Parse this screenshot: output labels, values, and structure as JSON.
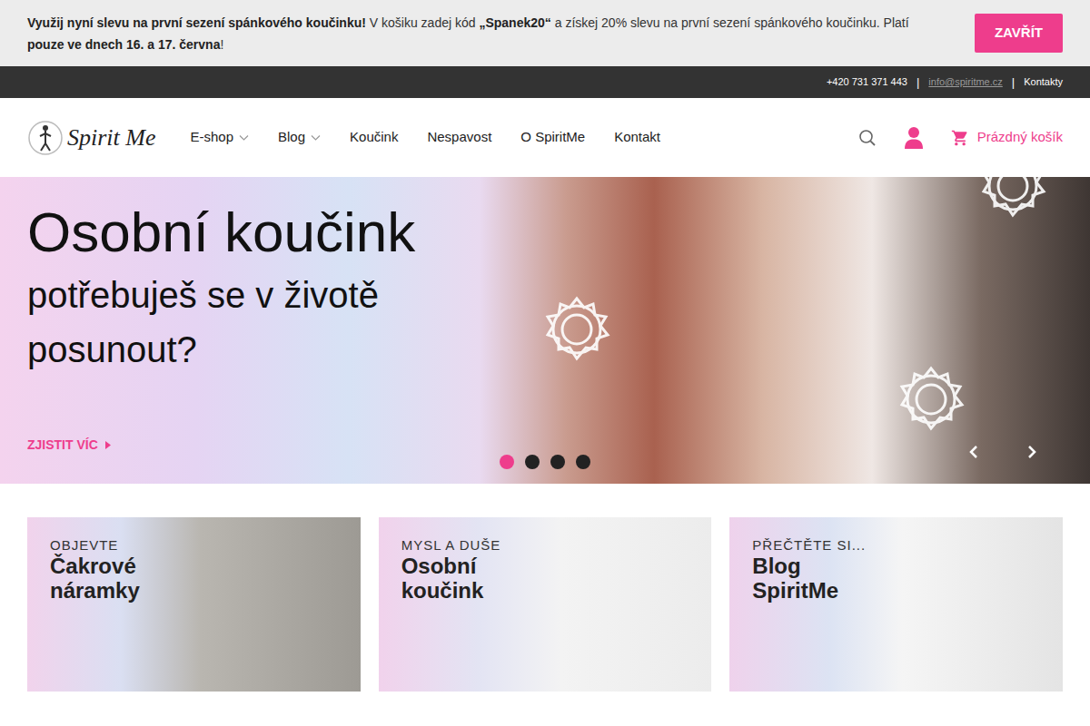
{
  "banner": {
    "segments": [
      {
        "text": "Využij nyní slevu na první sezení spánkového koučinku!",
        "bold": true
      },
      {
        "text": " V košiku zadej kód ",
        "bold": false
      },
      {
        "text": "„Spanek20“",
        "bold": true
      },
      {
        "text": " a získej 20% slevu na první sezení spánkového koučinku. Platí ",
        "bold": false
      },
      {
        "text": "pouze ve dnech 16. a 17. června",
        "bold": true
      },
      {
        "text": "!",
        "bold": false
      }
    ],
    "close": "ZAVŘÍT"
  },
  "topbar": {
    "separator": "|",
    "items": [
      {
        "text": "+420 731 371 443",
        "kind": "phone"
      },
      {
        "text": "info@spiritme.cz",
        "kind": "email"
      },
      {
        "text": "Kontakty",
        "kind": "link"
      }
    ]
  },
  "logo": {
    "text": "Spirit Me"
  },
  "nav": [
    {
      "label": "E-shop",
      "dropdown": true
    },
    {
      "label": "Blog",
      "dropdown": true
    },
    {
      "label": "Koučink",
      "dropdown": false
    },
    {
      "label": "Nespavost",
      "dropdown": false
    },
    {
      "label": "O SpiritMe",
      "dropdown": false
    },
    {
      "label": "Kontakt",
      "dropdown": false
    }
  ],
  "cart": {
    "label": "Prázdný košík"
  },
  "hero": {
    "title": "Osobní koučink",
    "subtitle_lines": [
      "potřebuješ se v životě",
      "posunout?"
    ],
    "cta": "ZJISTIT VÍC",
    "slides": [
      {
        "selected": true
      },
      {
        "selected": false
      },
      {
        "selected": false
      },
      {
        "selected": false
      }
    ]
  },
  "cards": [
    {
      "eyebrow": "OBJEVTE",
      "title_lines": [
        "Čakrové",
        "náramky"
      ]
    },
    {
      "eyebrow": "MYSL A DUŠE",
      "title_lines": [
        "Osobní",
        "koučink"
      ]
    },
    {
      "eyebrow": "PŘEČTĚTE SI...",
      "title_lines": [
        "Blog",
        "SpiritMe"
      ]
    }
  ]
}
